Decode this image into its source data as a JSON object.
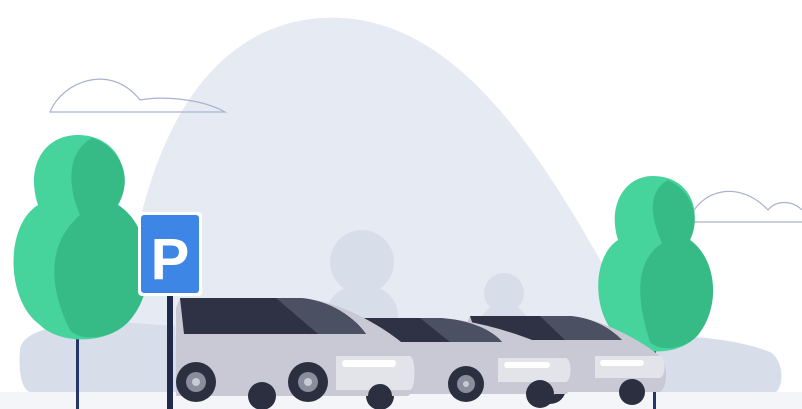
{
  "scene": {
    "description_label": "",
    "parking_sign": {
      "letter": "P"
    },
    "colors": {
      "background": "#ffffff",
      "hill": "#e6eaf2",
      "hill_shadow": "#dde3ee",
      "silhouette": "#d7deea",
      "cloud_stroke": "#a9b3cf",
      "tree_light": "#47d39c",
      "tree_dark": "#36ba86",
      "trunk": "#23356a",
      "sign_blue": "#3d86e6",
      "sign_border": "#ffffff",
      "pole": "#1f2a4a",
      "car_body": "#c9c9d6",
      "car_body_light": "#e3e3ea",
      "car_glass": "#2f3244",
      "car_glass_light": "#4c5063",
      "car_lamp": "#ffffff",
      "wheel_tire": "#2c2f3f",
      "wheel_rim": "#8a8d9c",
      "wheel_hub": "#c7c9d3"
    },
    "icons": [
      "parking-sign-icon",
      "tree-icon",
      "car-icon",
      "cloud-icon"
    ]
  }
}
